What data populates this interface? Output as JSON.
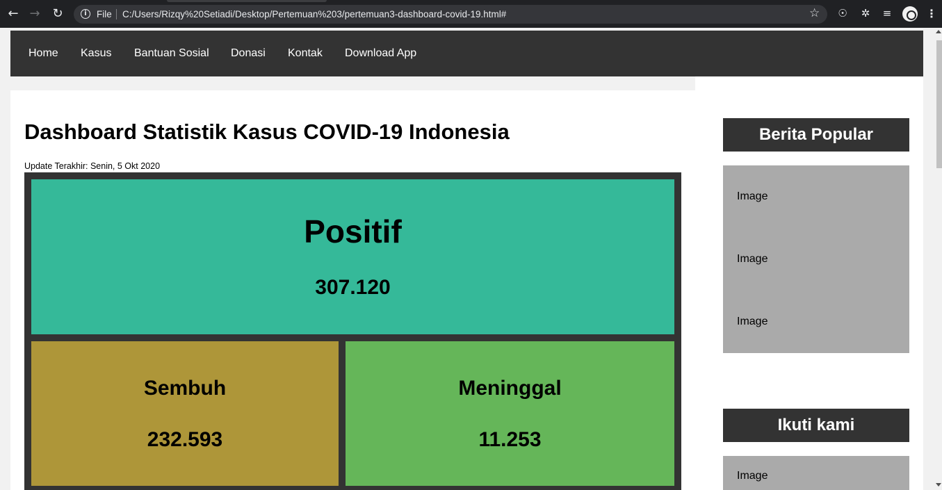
{
  "browser": {
    "back_icon": "arrow-left-icon",
    "forward_icon": "arrow-right-icon",
    "reload_icon": "reload-icon",
    "scheme": "File",
    "url": "C:/Users/Rizqy%20Setiadi/Desktop/Pertemuan%203/pertemuan3-dashboard-covid-19.html#",
    "bookmark_icon": "star-icon",
    "extension_icons": [
      "globe-icon",
      "puzzle-icon",
      "playlist-icon"
    ],
    "menu_icon": "kebab-icon"
  },
  "nav": {
    "items": [
      "Home",
      "Kasus",
      "Bantuan Sosial",
      "Donasi",
      "Kontak",
      "Download App"
    ]
  },
  "main": {
    "title": "Dashboard Statistik Kasus COVID-19 Indonesia",
    "updated": "Update Terakhir: Senin, 5 Okt 2020",
    "cards": {
      "positif": {
        "label": "Positif",
        "value": "307.120",
        "color": "#35b999"
      },
      "sembuh": {
        "label": "Sembuh",
        "value": "232.593",
        "color": "#ae9639"
      },
      "meninggal": {
        "label": "Meninggal",
        "value": "11.253",
        "color": "#65b659"
      }
    }
  },
  "sidebar": {
    "popular": {
      "title": "Berita Popular",
      "images": [
        "Image",
        "Image",
        "Image"
      ]
    },
    "follow": {
      "title": "Ikuti kami",
      "images": [
        "Image"
      ]
    }
  },
  "colors": {
    "nav_bg": "#333333",
    "image_placeholder": "#aaaaaa"
  }
}
